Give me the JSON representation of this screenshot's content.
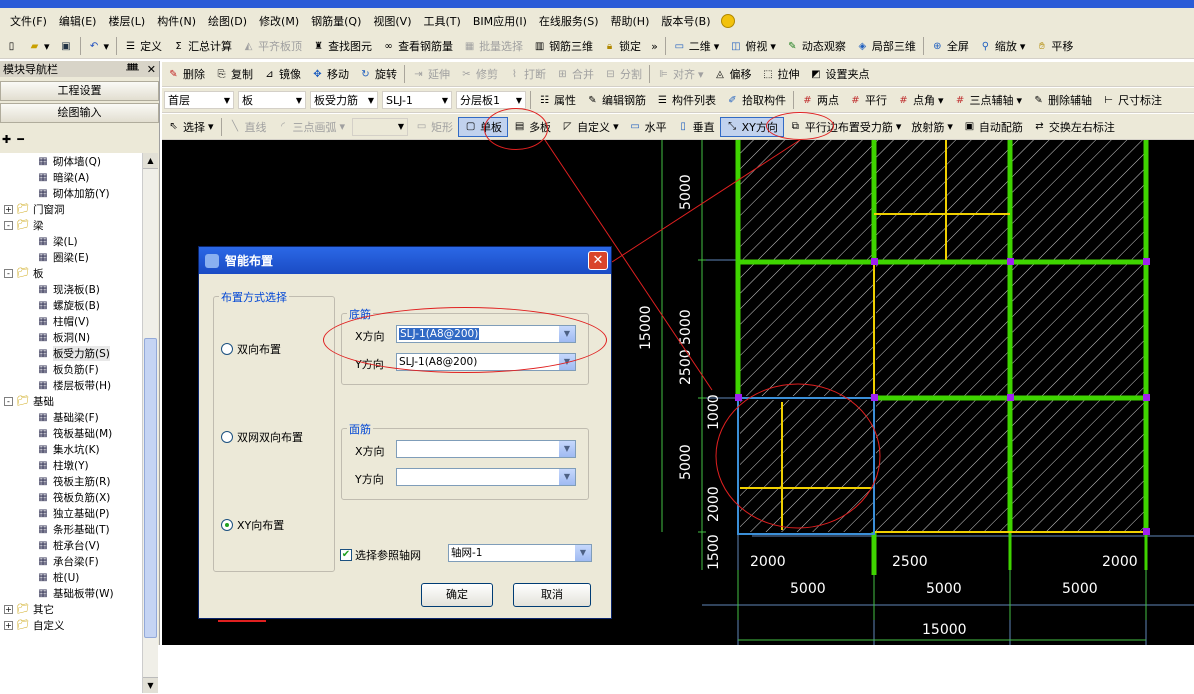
{
  "menu": [
    "文件(F)",
    "编辑(E)",
    "楼层(L)",
    "构件(N)",
    "绘图(D)",
    "修改(M)",
    "钢筋量(Q)",
    "视图(V)",
    "工具(T)",
    "BIM应用(I)",
    "在线服务(S)",
    "帮助(H)",
    "版本号(B)"
  ],
  "toolbar1": {
    "define": "定义",
    "sum_calc": "汇总计算",
    "slab_top": "平齐板顶",
    "find_elem": "查找图元",
    "view_rebar": "查看钢筋量",
    "batch_select": "批量选择",
    "rebar_3d": "钢筋三维",
    "lock": "锁定",
    "view_2d": "二维",
    "top_view": "俯视",
    "dyn_view": "动态观察",
    "local_3d": "局部三维",
    "full_screen": "全屏",
    "zoom": "缩放",
    "pan": "平移"
  },
  "toolbar2": {
    "delete": "删除",
    "copy": "复制",
    "mirror": "镜像",
    "move": "移动",
    "rotate": "旋转",
    "extend": "延伸",
    "trim": "修剪",
    "break": "打断",
    "merge": "合并",
    "split": "分割",
    "align": "对齐",
    "offset": "偏移",
    "stretch": "拉伸",
    "set_node": "设置夹点"
  },
  "toolbar3": {
    "floor": "首层",
    "category": "板",
    "type": "板受力筋",
    "item": "SLJ-1",
    "layer": "分层板1",
    "property": "属性",
    "edit_rebar": "编辑钢筋",
    "comp_list": "构件列表",
    "pick": "拾取构件",
    "two_point": "两点",
    "parallel": "平行",
    "point_angle": "点角",
    "three_point_aux": "三点辅轴",
    "del_aux": "删除辅轴",
    "dim": "尺寸标注"
  },
  "toolbar4": {
    "select": "选择",
    "line": "直线",
    "arc3": "三点画弧",
    "rect": "矩形",
    "single": "单板",
    "multi": "多板",
    "custom": "自定义",
    "horizontal": "水平",
    "vertical": "垂直",
    "xy_dir": "XY方向",
    "parallel_edge": "平行边布置受力筋",
    "radial": "放射筋",
    "auto_rebar": "自动配筋",
    "swap_label": "交换左右标注"
  },
  "left": {
    "title": "模块导航栏",
    "btn_project": "工程设置",
    "btn_draw": "绘图输入",
    "tree": [
      {
        "label": "砌体墙(Q)",
        "level": 2,
        "icon": "wall-icon"
      },
      {
        "label": "暗梁(A)",
        "level": 2,
        "icon": "beam-icon"
      },
      {
        "label": "砌体加筋(Y)",
        "level": 2,
        "icon": "rebar-icon"
      },
      {
        "label": "门窗洞",
        "level": 0,
        "exp": "+",
        "icon": "folder-icon"
      },
      {
        "label": "梁",
        "level": 0,
        "exp": "-",
        "icon": "folder-icon"
      },
      {
        "label": "梁(L)",
        "level": 2,
        "icon": "beam-icon"
      },
      {
        "label": "圈梁(E)",
        "level": 2,
        "icon": "beam-icon"
      },
      {
        "label": "板",
        "level": 0,
        "exp": "-",
        "icon": "folder-icon"
      },
      {
        "label": "现浇板(B)",
        "level": 2,
        "icon": "slab-icon"
      },
      {
        "label": "螺旋板(B)",
        "level": 2,
        "icon": "slab-icon"
      },
      {
        "label": "柱帽(V)",
        "level": 2,
        "icon": "column-icon"
      },
      {
        "label": "板洞(N)",
        "level": 2,
        "icon": "hole-icon"
      },
      {
        "label": "板受力筋(S)",
        "level": 2,
        "icon": "rebar-icon",
        "selected": true
      },
      {
        "label": "板负筋(F)",
        "level": 2,
        "icon": "rebar-icon"
      },
      {
        "label": "楼层板带(H)",
        "level": 2,
        "icon": "band-icon"
      },
      {
        "label": "基础",
        "level": 0,
        "exp": "-",
        "icon": "folder-icon"
      },
      {
        "label": "基础梁(F)",
        "level": 2,
        "icon": "beam-icon"
      },
      {
        "label": "筏板基础(M)",
        "level": 2,
        "icon": "slab-icon"
      },
      {
        "label": "集水坑(K)",
        "level": 2,
        "icon": "pit-icon"
      },
      {
        "label": "柱墩(Y)",
        "level": 2,
        "icon": "column-icon"
      },
      {
        "label": "筏板主筋(R)",
        "level": 2,
        "icon": "rebar-icon"
      },
      {
        "label": "筏板负筋(X)",
        "level": 2,
        "icon": "rebar-icon"
      },
      {
        "label": "独立基础(P)",
        "level": 2,
        "icon": "footing-icon"
      },
      {
        "label": "条形基础(T)",
        "level": 2,
        "icon": "footing-icon"
      },
      {
        "label": "桩承台(V)",
        "level": 2,
        "icon": "cap-icon"
      },
      {
        "label": "承台梁(F)",
        "level": 2,
        "icon": "beam-icon"
      },
      {
        "label": "桩(U)",
        "level": 2,
        "icon": "pile-icon"
      },
      {
        "label": "基础板带(W)",
        "level": 2,
        "icon": "band-icon"
      },
      {
        "label": "其它",
        "level": 0,
        "exp": "+",
        "icon": "folder-icon"
      },
      {
        "label": "自定义",
        "level": 0,
        "exp": "+",
        "icon": "folder-icon"
      }
    ]
  },
  "dialog": {
    "title": "智能布置",
    "group_mode": "布置方式选择",
    "radio_two_way": "双向布置",
    "radio_double_net": "双网双向布置",
    "radio_xy": "XY向布置",
    "group_bottom": "底筋",
    "group_top": "面筋",
    "x_label": "X方向",
    "y_label": "Y方向",
    "bottom_x_value": "SLJ-1(A8@200)",
    "bottom_y_value": "SLJ-1(A8@200)",
    "top_x_value": "",
    "top_y_value": "",
    "check_grid": "选择参照轴网",
    "grid_value": "轴网-1",
    "ok": "确定",
    "cancel": "取消"
  },
  "drawing": {
    "dims_vertical": [
      "5000",
      "15000",
      "5000",
      "2500",
      "1000",
      "5000",
      "2000",
      "1500"
    ],
    "dims_bottom_sub": [
      "2000",
      "2500",
      "2000"
    ],
    "dims_bottom_main": [
      "5000",
      "5000",
      "5000"
    ],
    "dims_total": "15000"
  },
  "colors": {
    "beam": "#3fd400",
    "rebar": "#f0d000",
    "highlight_red": "#e02020",
    "grid": "#7aa0d0"
  }
}
